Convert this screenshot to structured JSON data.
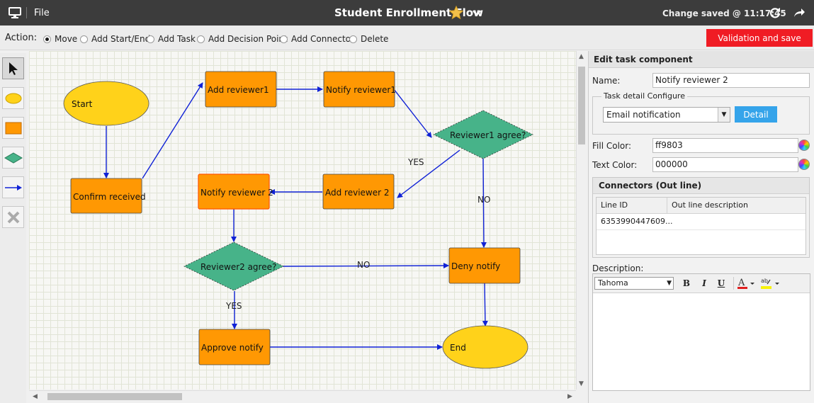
{
  "topbar": {
    "file_label": "File",
    "title": "Student Enrollment Flow",
    "status": "Change saved @ 11:17:45",
    "icons": [
      "monitor-icon",
      "star-icon",
      "chevron-down-icon",
      "refresh-icon",
      "share-icon"
    ]
  },
  "actionbar": {
    "label": "Action:",
    "options": [
      "Move",
      "Add Start/End",
      "Add Task",
      "Add Decision Point",
      "Add Connector",
      "Delete"
    ],
    "selected": "Move",
    "validate_label": "Validation and save",
    "validate_color": "#f01c24"
  },
  "tools": [
    "pointer-tool-icon",
    "ellipse-tool-icon",
    "rectangle-tool-icon",
    "diamond-tool-icon",
    "connector-tool-icon",
    "delete-tool-icon"
  ],
  "flow": {
    "nodes": {
      "start": "Start",
      "confirm": "Confirm received",
      "add_rev1": "Add reviewer1",
      "notify_rev1": "Notify reviewer1",
      "rev1_agree": "Reviewer1 agree?",
      "add_rev2": "Add reviewer 2",
      "notify_rev2": "Notify reviewer 2",
      "rev2_agree": "Reviewer2 agree?",
      "deny": "Deny notify",
      "approve": "Approve notify",
      "end": "End"
    },
    "edge_labels": {
      "rev1_yes": "YES",
      "rev1_no": "NO",
      "rev2_no": "NO",
      "rev2_yes": "YES"
    },
    "colors": {
      "start_end_fill": "#ffd21a",
      "task_fill": "#ff9803",
      "decision_fill": "#47b389",
      "connector": "#1022d6",
      "selected_border": "#ff5500"
    }
  },
  "panel": {
    "header": "Edit task component",
    "name_label": "Name:",
    "name_value": "Notify reviewer 2",
    "task_detail_legend": "Task detail Configure",
    "task_type": "Email notification",
    "detail_label": "Detail",
    "fill_color_label": "Fill Color:",
    "fill_color_value": "ff9803",
    "text_color_label": "Text Color:",
    "text_color_value": "000000",
    "connectors_header": "Connectors (Out line)",
    "connector_columns": [
      "Line ID",
      "Out line description"
    ],
    "connector_rows": [
      [
        "6353990447609...",
        ""
      ]
    ],
    "description_label": "Description:",
    "font_name": "Tahoma",
    "format_buttons": [
      "B",
      "I",
      "U"
    ]
  }
}
